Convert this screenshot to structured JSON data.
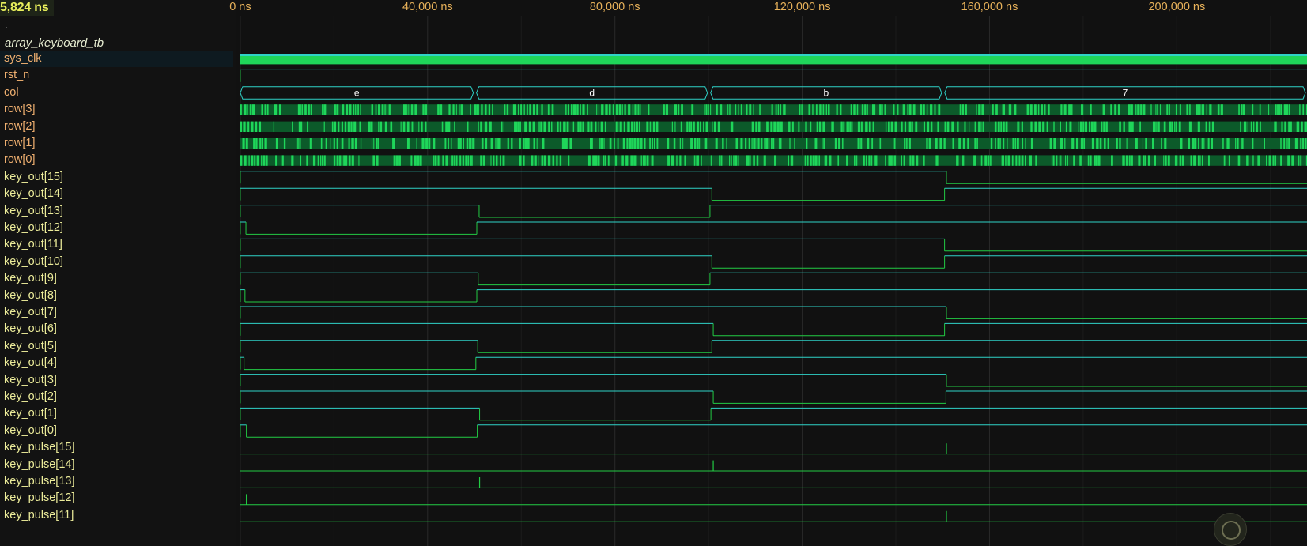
{
  "toolbar": {
    "cursor_time": "5,824 ns",
    "scope_marker": ".",
    "scope_name": "array_keyboard_tb"
  },
  "timeline": {
    "range_ns": [
      -1000,
      227800
    ],
    "ticks": [
      {
        "ns": 0,
        "label": "0 ns"
      },
      {
        "ns": 40000,
        "label": "40,000 ns"
      },
      {
        "ns": 80000,
        "label": "80,000 ns"
      },
      {
        "ns": 120000,
        "label": "120,000 ns"
      },
      {
        "ns": 160000,
        "label": "160,000 ns"
      },
      {
        "ns": 200000,
        "label": "200,000 ns"
      }
    ]
  },
  "colors": {
    "input_name": "#f0b070",
    "output_name": "#ecec9a",
    "wave_cyan": "#2fd3c8",
    "wave_green": "#22cc44",
    "dense_green": "#1fd65a",
    "grid": "#2a2a2a",
    "bus_text": "#ffffff"
  },
  "signals": [
    {
      "name": "sys_clk",
      "kind": "input",
      "type": "clock"
    },
    {
      "name": "rst_n",
      "kind": "input",
      "type": "bit",
      "edges": [
        [
          0,
          1
        ]
      ]
    },
    {
      "name": "col",
      "kind": "input",
      "type": "bus",
      "segments": [
        {
          "start": 0,
          "end": 50100,
          "value": "e"
        },
        {
          "start": 50100,
          "end": 100100,
          "value": "d"
        },
        {
          "start": 100100,
          "end": 150100,
          "value": "b"
        },
        {
          "start": 150100,
          "end": 227800,
          "value": "7"
        }
      ]
    },
    {
      "name": "row[3]",
      "kind": "input",
      "type": "dense"
    },
    {
      "name": "row[2]",
      "kind": "input",
      "type": "dense"
    },
    {
      "name": "row[1]",
      "kind": "input",
      "type": "dense"
    },
    {
      "name": "row[0]",
      "kind": "input",
      "type": "dense"
    },
    {
      "name": "key_out[15]",
      "kind": "output",
      "type": "bit",
      "edges": [
        [
          0,
          1
        ],
        [
          150800,
          0
        ]
      ]
    },
    {
      "name": "key_out[14]",
      "kind": "output",
      "type": "bit",
      "edges": [
        [
          0,
          1
        ],
        [
          100700,
          0
        ],
        [
          150400,
          1
        ]
      ]
    },
    {
      "name": "key_out[13]",
      "kind": "output",
      "type": "bit",
      "edges": [
        [
          0,
          1
        ],
        [
          51000,
          0
        ],
        [
          100300,
          1
        ]
      ]
    },
    {
      "name": "key_out[12]",
      "kind": "output",
      "type": "bit",
      "edges": [
        [
          0,
          1
        ],
        [
          1200,
          0
        ],
        [
          50500,
          1
        ]
      ]
    },
    {
      "name": "key_out[11]",
      "kind": "output",
      "type": "bit",
      "edges": [
        [
          0,
          1
        ],
        [
          150400,
          0
        ]
      ]
    },
    {
      "name": "key_out[10]",
      "kind": "output",
      "type": "bit",
      "edges": [
        [
          0,
          1
        ],
        [
          100700,
          0
        ],
        [
          150400,
          1
        ]
      ]
    },
    {
      "name": "key_out[9]",
      "kind": "output",
      "type": "bit",
      "edges": [
        [
          0,
          1
        ],
        [
          50800,
          0
        ],
        [
          100300,
          1
        ]
      ]
    },
    {
      "name": "key_out[8]",
      "kind": "output",
      "type": "bit",
      "edges": [
        [
          0,
          1
        ],
        [
          1000,
          0
        ],
        [
          50500,
          1
        ]
      ]
    },
    {
      "name": "key_out[7]",
      "kind": "output",
      "type": "bit",
      "edges": [
        [
          0,
          1
        ],
        [
          150800,
          0
        ]
      ]
    },
    {
      "name": "key_out[6]",
      "kind": "output",
      "type": "bit",
      "edges": [
        [
          0,
          1
        ],
        [
          101000,
          0
        ],
        [
          150400,
          1
        ]
      ]
    },
    {
      "name": "key_out[5]",
      "kind": "output",
      "type": "bit",
      "edges": [
        [
          0,
          1
        ],
        [
          50700,
          0
        ],
        [
          100700,
          1
        ]
      ]
    },
    {
      "name": "key_out[4]",
      "kind": "output",
      "type": "bit",
      "edges": [
        [
          0,
          1
        ],
        [
          800,
          0
        ],
        [
          50300,
          1
        ]
      ]
    },
    {
      "name": "key_out[3]",
      "kind": "output",
      "type": "bit",
      "edges": [
        [
          0,
          1
        ],
        [
          150800,
          0
        ]
      ]
    },
    {
      "name": "key_out[2]",
      "kind": "output",
      "type": "bit",
      "edges": [
        [
          0,
          1
        ],
        [
          101000,
          0
        ],
        [
          150700,
          1
        ]
      ]
    },
    {
      "name": "key_out[1]",
      "kind": "output",
      "type": "bit",
      "edges": [
        [
          0,
          1
        ],
        [
          51100,
          0
        ],
        [
          100500,
          1
        ]
      ]
    },
    {
      "name": "key_out[0]",
      "kind": "output",
      "type": "bit",
      "edges": [
        [
          0,
          1
        ],
        [
          1300,
          0
        ],
        [
          50600,
          1
        ]
      ]
    },
    {
      "name": "key_pulse[15]",
      "kind": "output",
      "type": "pulse",
      "pulses": [
        150800
      ]
    },
    {
      "name": "key_pulse[14]",
      "kind": "output",
      "type": "pulse",
      "pulses": [
        101000
      ]
    },
    {
      "name": "key_pulse[13]",
      "kind": "output",
      "type": "pulse",
      "pulses": [
        51100
      ]
    },
    {
      "name": "key_pulse[12]",
      "kind": "output",
      "type": "pulse",
      "pulses": [
        1300
      ]
    },
    {
      "name": "key_pulse[11]",
      "kind": "output",
      "type": "pulse",
      "pulses": [
        150800
      ]
    }
  ]
}
